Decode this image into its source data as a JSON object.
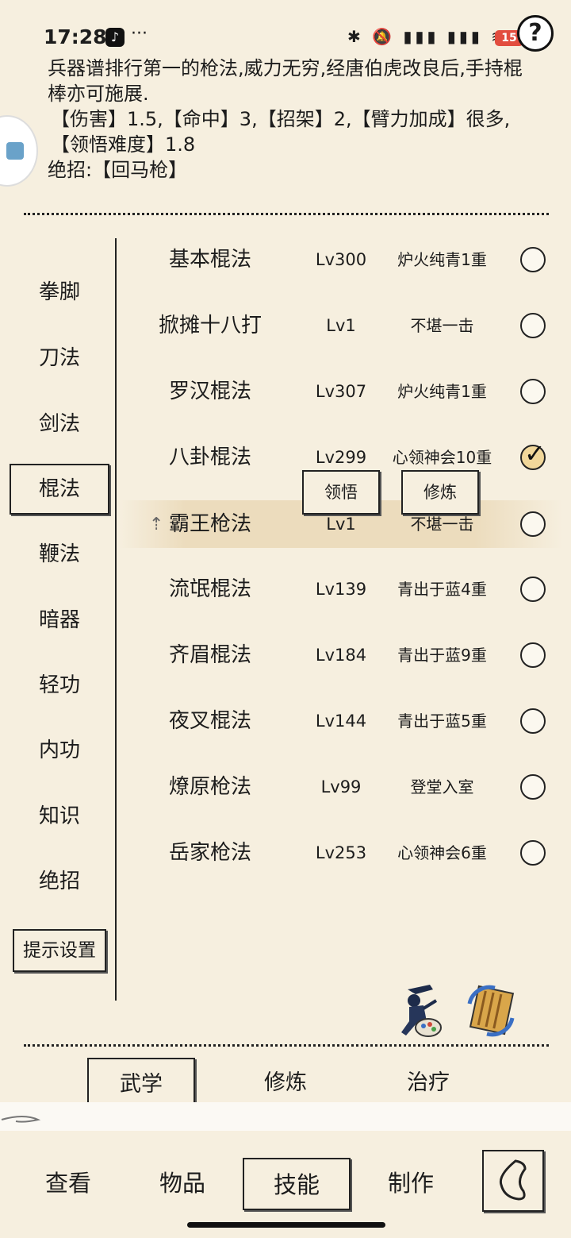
{
  "status": {
    "time": "17:28",
    "dots": "···",
    "icons": "✱ 🔕 ▮▮▮ ▮▮▮ ≋",
    "battery": "15"
  },
  "help_label": "?",
  "description": {
    "line1": "兵器谱排行第一的枪法,威力无穷,经唐伯虎改良后,手持棍棒亦可施展.",
    "line2": "【伤害】1.5,【命中】3,【招架】2,【臂力加成】很多,【领悟难度】1.8",
    "line3": "绝招:【回马枪】"
  },
  "categories": [
    "拳脚",
    "刀法",
    "剑法",
    "棍法",
    "鞭法",
    "暗器",
    "轻功",
    "内功",
    "知识",
    "绝招"
  ],
  "active_category": "棍法",
  "hint_settings": "提示设置",
  "skills": [
    {
      "name": "基本棍法",
      "lv": "Lv300",
      "rank": "炉火纯青1重",
      "checked": false
    },
    {
      "name": "掀摊十八打",
      "lv": "Lv1",
      "rank": "不堪一击",
      "checked": false
    },
    {
      "name": "罗汉棍法",
      "lv": "Lv307",
      "rank": "炉火纯青1重",
      "checked": false
    },
    {
      "name": "八卦棍法",
      "lv": "Lv299",
      "rank": "心领神会10重",
      "checked": true
    },
    {
      "name": "霸王枪法",
      "lv": "Lv1",
      "rank": "不堪一击",
      "checked": false
    },
    {
      "name": "流氓棍法",
      "lv": "Lv139",
      "rank": "青出于蓝4重",
      "checked": false
    },
    {
      "name": "齐眉棍法",
      "lv": "Lv184",
      "rank": "青出于蓝9重",
      "checked": false
    },
    {
      "name": "夜叉棍法",
      "lv": "Lv144",
      "rank": "青出于蓝5重",
      "checked": false
    },
    {
      "name": "燎原枪法",
      "lv": "Lv99",
      "rank": "登堂入室",
      "checked": false
    },
    {
      "name": "岳家枪法",
      "lv": "Lv253",
      "rank": "心领神会6重",
      "checked": false
    }
  ],
  "popup": {
    "comprehend": "领悟",
    "practice": "修炼"
  },
  "subtabs": [
    "武学",
    "修炼",
    "治疗"
  ],
  "navtabs": [
    "查看",
    "物品",
    "技能",
    "制作"
  ]
}
